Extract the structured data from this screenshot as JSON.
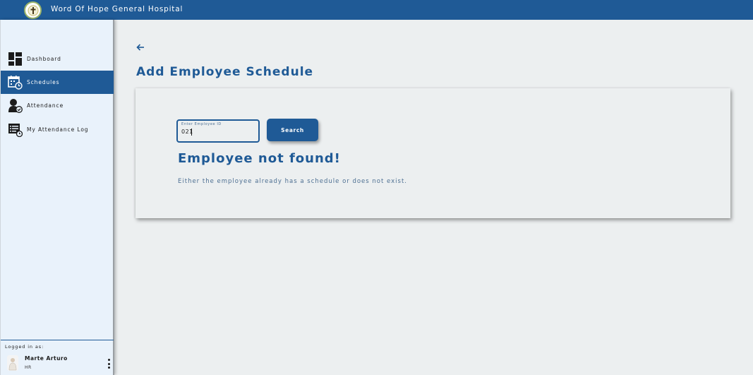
{
  "header": {
    "app_title": "Word Of Hope General Hospital"
  },
  "sidebar": {
    "items": [
      {
        "label": "Dashboard",
        "icon": "dashboard-icon",
        "active": false
      },
      {
        "label": "Schedules",
        "icon": "calendar-clock-icon",
        "active": true
      },
      {
        "label": "Attendance",
        "icon": "user-check-icon",
        "active": false
      },
      {
        "label": "My Attendance Log",
        "icon": "log-clock-icon",
        "active": false
      }
    ],
    "footer": {
      "logged_in_label": "Logged in as:",
      "user_name": "Marte Arturo",
      "user_role": "HR"
    }
  },
  "main": {
    "title": "Add Employee Schedule",
    "search": {
      "label": "Enter Employee ID",
      "value": "021",
      "button_label": "Search"
    },
    "result": {
      "heading": "Employee not found!",
      "message": "Either the employee already has a schedule or does not exist."
    }
  },
  "colors": {
    "primary": "#1f5a96",
    "background": "#eceff0",
    "sidebar_bg": "#e9f2fb"
  }
}
